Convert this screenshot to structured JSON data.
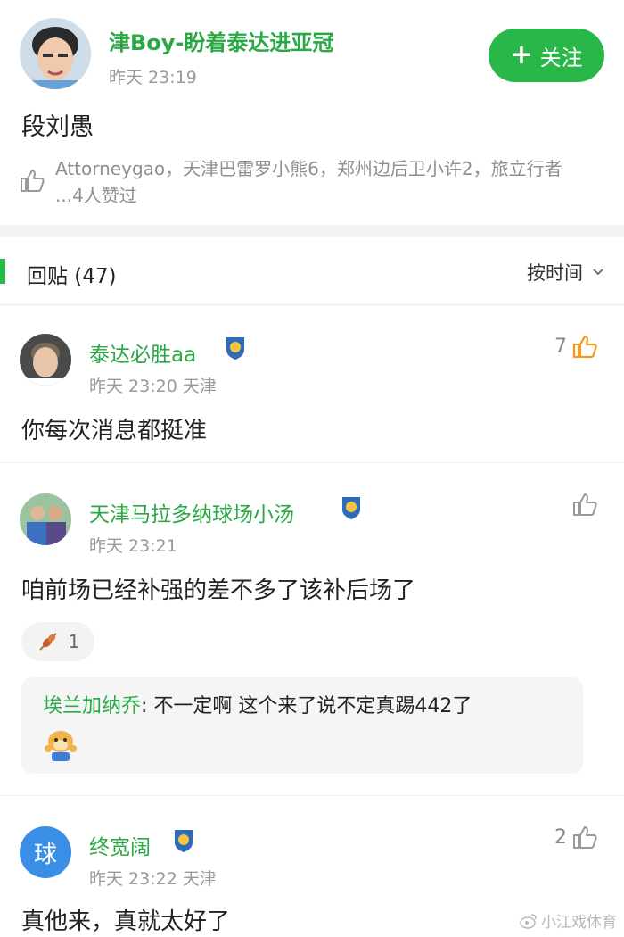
{
  "post": {
    "author": "津Boy-盼着泰达进亚冠",
    "time": "昨天 23:19",
    "follow_label": "关注",
    "content": "段刘愚",
    "likers": "Attorneygao，天津巴雷罗小熊6，郑州边后卫小许2，旅立行者 ...4人赞过"
  },
  "replies": {
    "title": "回贴 (47)",
    "sort_label": "按时间"
  },
  "comments": [
    {
      "name": "泰达必胜aa",
      "meta": "昨天 23:20  天津",
      "likes": "7",
      "text": "你每次消息都挺准"
    },
    {
      "name": "天津马拉多纳球场小汤",
      "meta": "昨天 23:21",
      "likes": "",
      "text": "咱前场已经补强的差不多了该补后场了",
      "reaction_count": "1",
      "sub_reply": {
        "name": "埃兰加纳乔",
        "text": ": 不一定啊 这个来了说不定真踢442了"
      }
    },
    {
      "name": "终宽阔",
      "avatar_letter": "球",
      "meta": "昨天 23:22  天津",
      "likes": "2",
      "text": "真他来，真就太好了"
    }
  ],
  "watermark": "小江戏体育",
  "colors": {
    "accent_green": "#2ab74a",
    "name_green": "#2aa845",
    "meta_gray": "#9a9a9a",
    "like_orange": "#f39a1e"
  }
}
